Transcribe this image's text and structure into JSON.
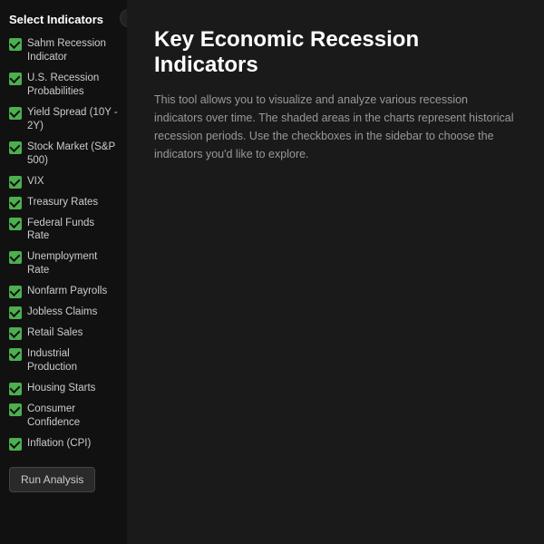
{
  "sidebar": {
    "title": "Select Indicators",
    "collapse_icon": "‹",
    "indicators": [
      {
        "id": "sahm",
        "label": "Sahm Recession Indicator",
        "checked": true
      },
      {
        "id": "us-recession",
        "label": "U.S. Recession Probabilities",
        "checked": true
      },
      {
        "id": "yield-spread",
        "label": "Yield Spread (10Y - 2Y)",
        "checked": true
      },
      {
        "id": "stock-market",
        "label": "Stock Market (S&P 500)",
        "checked": true
      },
      {
        "id": "vix",
        "label": "VIX",
        "checked": true
      },
      {
        "id": "treasury",
        "label": "Treasury Rates",
        "checked": true
      },
      {
        "id": "fed-funds",
        "label": "Federal Funds Rate",
        "checked": true
      },
      {
        "id": "unemployment",
        "label": "Unemployment Rate",
        "checked": true
      },
      {
        "id": "nonfarm",
        "label": "Nonfarm Payrolls",
        "checked": true
      },
      {
        "id": "jobless",
        "label": "Jobless Claims",
        "checked": true
      },
      {
        "id": "retail",
        "label": "Retail Sales",
        "checked": true
      },
      {
        "id": "industrial",
        "label": "Industrial Production",
        "checked": true
      },
      {
        "id": "housing",
        "label": "Housing Starts",
        "checked": true
      },
      {
        "id": "consumer",
        "label": "Consumer Confidence",
        "checked": true
      },
      {
        "id": "inflation",
        "label": "Inflation (CPI)",
        "checked": true
      }
    ],
    "run_button_label": "Run Analysis"
  },
  "main": {
    "title": "Key Economic Recession Indicators",
    "description": "This tool allows you to visualize and analyze various recession indicators over time. The shaded areas in the charts represent historical recession periods. Use the checkboxes in the sidebar to choose the indicators you'd like to explore."
  }
}
